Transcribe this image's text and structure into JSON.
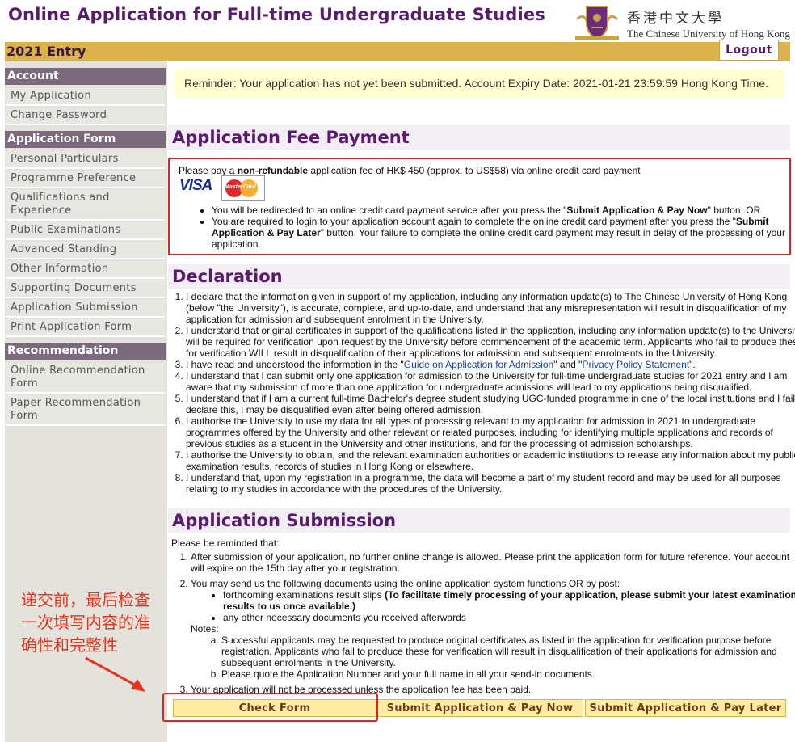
{
  "header": {
    "title": "Online Application for Full-time Undergraduate Studies",
    "logo_cn": "香港中文大學",
    "logo_en": "The Chinese University of Hong Kong",
    "entry": "2021 Entry",
    "logout": "Logout"
  },
  "sidebar": {
    "account_head": "Account",
    "account_items": [
      "My Application",
      "Change Password"
    ],
    "form_head": "Application Form",
    "form_items": [
      "Personal Particulars",
      "Programme Preference",
      "Qualifications and Experience",
      "Public Examinations",
      "Advanced Standing",
      "Other Information",
      "Supporting Documents",
      "Application Submission",
      "Print Application Form"
    ],
    "rec_head": "Recommendation",
    "rec_items": [
      "Online Recommendation Form",
      "Paper Recommendation Form"
    ]
  },
  "reminder": "Reminder: Your application has not yet been submitted. Account Expiry Date: 2021-01-21 23:59:59 Hong Kong Time.",
  "fee": {
    "heading": "Application Fee Payment",
    "line_pre": "Please pay a ",
    "line_bold": "non-refundable",
    "line_post": " application fee of HK$ 450  (approx. to US$58) via online credit card payment",
    "visa": "VISA",
    "mastercard": "MasterCard",
    "bullet1_pre": "You will be redirected to an online credit card payment service after you press the \"",
    "bullet1_bold": "Submit Application & Pay Now",
    "bullet1_post": "\" button; OR",
    "bullet2_pre": "You are required to login to your application account again to complete the online credit card payment after you press the \"",
    "bullet2_bold": "Submit Application & Pay Later",
    "bullet2_post": "\" button. Your failure to complete the online credit card payment may result in delay of the processing of your application."
  },
  "declaration": {
    "heading": "Declaration",
    "items": [
      "I declare that the information given in support of my application, including any information update(s) to The Chinese University of Hong Kong (below \"the University\"), is accurate, complete, and up-to-date, and understand that any misrepresentation will result in disqualification of my application for admission and subsequent enrolment in the University.",
      "I understand that original certificates in support of the qualifications listed in the application, including any information update(s) to the University, will be required for verification upon request by the University before commencement of the academic term. Applicants who fail to produce these for verification WILL result in disqualification of their applications for admission and subsequent enrolments in the University."
    ],
    "item3_pre": "I have read and understood the information in the \"",
    "item3_link1": "Guide on Application for Admission",
    "item3_mid": "\" and \"",
    "item3_link2": "Privacy Policy Statement",
    "item3_post": "\".",
    "items_rest": [
      "I understand that I can submit only one application for admission to the University for full-time undergraduate studies for 2021 entry and I am aware that my submission of more than one application for undergraduate admissions will lead to my applications being disqualified.",
      "I understand that if I am a current full-time Bachelor's degree student studying UGC-funded programme in one of the local institutions and I fail to declare this, I may be disqualified even after being offered admission.",
      "I authorise the University to use my data for all types of processing relevant to my application for admission in 2021 to undergraduate programmes offered by the University and other relevant or related purposes, including for identifying multiple applications and records of previous studies as a student in the University and other institutions, and for the processing of admission scholarships.",
      "I authorise the University to obtain, and the relevant examination authorities or academic institutions to release any information about my public examination results, records of studies in Hong Kong or elsewhere.",
      "I understand that, upon my registration in a programme, the data will become a part of my student record and may be used for all purposes relating to my studies in accordance with the procedures of the University."
    ]
  },
  "submission": {
    "heading": "Application Submission",
    "intro": "Please be reminded that:",
    "item1": "After submission of your application, no further online change is allowed. Please print the application form for future reference. Your account will expire on the 15th day after your registration.",
    "item2": "You may send us the following documents using the online application system functions OR by post:",
    "sub1_pre": "forthcoming examinations result slips ",
    "sub1_bold": "(To facilitate timely processing of your application, please submit your latest examination results to us once available.)",
    "sub2": "any other necessary documents you received afterwards",
    "notes_label": "Notes:",
    "note_a": "Successful applicants may be requested to produce original certificates as listed in the application for verification purpose before registration. Applicants who fail to produce these for verification will result in disqualification of their applications for admission and subsequent enrolments in the University.",
    "note_b": "Please quote the Application Number and your full name in all your send-in documents.",
    "item3": "Your application will not be processed unless the application fee has been paid."
  },
  "annotation": "递交前，最后检查一次填写内容的准确性和完整性",
  "buttons": {
    "check": "Check Form",
    "pay_now": "Submit Application & Pay Now",
    "pay_later": "Submit Application & Pay Later"
  }
}
